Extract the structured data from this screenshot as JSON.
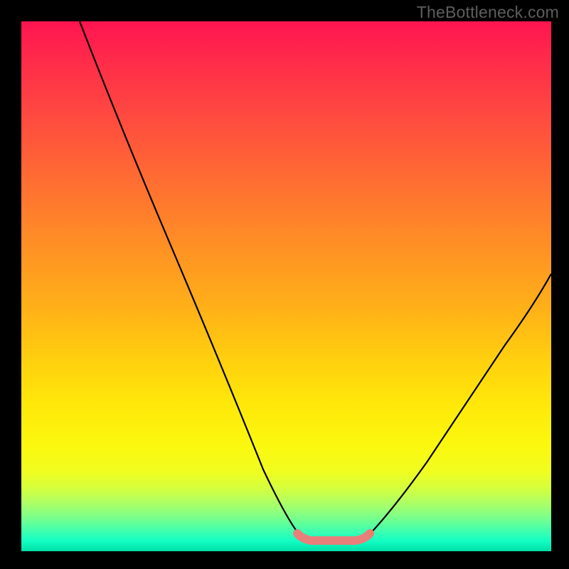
{
  "watermark": "TheBottleneck.com",
  "chart_data": {
    "type": "line",
    "title": "",
    "xlabel": "",
    "ylabel": "",
    "xlim": [
      0,
      100
    ],
    "ylim": [
      0,
      100
    ],
    "grid": false,
    "series": [
      {
        "name": "curve-left",
        "x": [
          11,
          15,
          20,
          25,
          30,
          35,
          40,
          45,
          50,
          53
        ],
        "values": [
          100,
          90,
          79,
          67.5,
          56,
          44.5,
          32.5,
          20,
          8,
          2.5
        ]
      },
      {
        "name": "curve-right",
        "x": [
          65,
          70,
          75,
          80,
          85,
          90,
          95,
          100
        ],
        "values": [
          2.5,
          10,
          19,
          27.5,
          35,
          42,
          48,
          53
        ]
      },
      {
        "name": "bottom-segment",
        "x": [
          53,
          55,
          57,
          59,
          61,
          63,
          65
        ],
        "values": [
          2.5,
          2.2,
          2.0,
          2.0,
          2.0,
          2.2,
          2.5
        ]
      }
    ],
    "annotations": {
      "pink_segment_x_range": [
        52,
        66
      ],
      "pink_segment_color": "#e97f7b"
    },
    "gradient_stops": [
      {
        "pos": 0,
        "color": "#ff1450"
      },
      {
        "pos": 50,
        "color": "#ffa020"
      },
      {
        "pos": 80,
        "color": "#f8fc10"
      },
      {
        "pos": 100,
        "color": "#00dfa8"
      }
    ]
  }
}
